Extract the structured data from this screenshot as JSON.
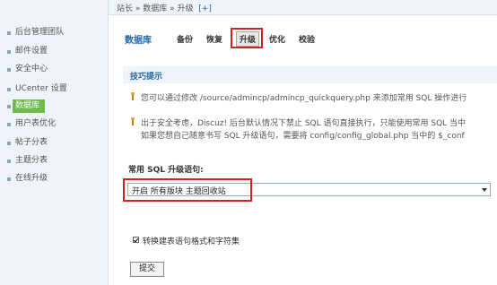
{
  "sidebar": {
    "items": [
      {
        "label": "后台管理团队",
        "active": false
      },
      {
        "label": "邮件设置",
        "active": false
      },
      {
        "label": "安全中心",
        "active": false
      },
      {
        "label": "UCenter 设置",
        "active": false
      },
      {
        "label": "数据库",
        "active": true
      },
      {
        "label": "用户表优化",
        "active": false
      },
      {
        "label": "帖子分表",
        "active": false
      },
      {
        "label": "主题分表",
        "active": false
      },
      {
        "label": "在线升级",
        "active": false
      }
    ]
  },
  "breadcrumb": {
    "site": "站长",
    "sep1": "»",
    "db": "数据库",
    "sep2": "»",
    "current": "升级",
    "add": "[+]"
  },
  "tabs": {
    "title": "数据库",
    "items": [
      "备份",
      "恢复",
      "升级",
      "优化",
      "校验"
    ],
    "current": "升级"
  },
  "tips": {
    "title": "技巧提示",
    "line1": "您可以通过修改 /source/admincp/admincp_quickquery.php 来添加常用 SQL 操作进行",
    "line2": "出于安全考虑，Discuz! 后台默认情况下禁止 SQL 语句直接执行，只能使用常用 SQL 当中",
    "line3": "如果您想自己随意书写 SQL 升级语句，需要将 config/config_global.php 当中的 $_conf"
  },
  "form": {
    "label": "常用 SQL 升级语句:",
    "select_value": "开启 所有版块 主题回收站",
    "checkbox_label": "转换建表语句格式和字符集",
    "submit_label": "提交"
  },
  "colors": {
    "accent": "#2366a8",
    "active_nav": "#6ebd4c",
    "highlight_border": "#d22222"
  }
}
